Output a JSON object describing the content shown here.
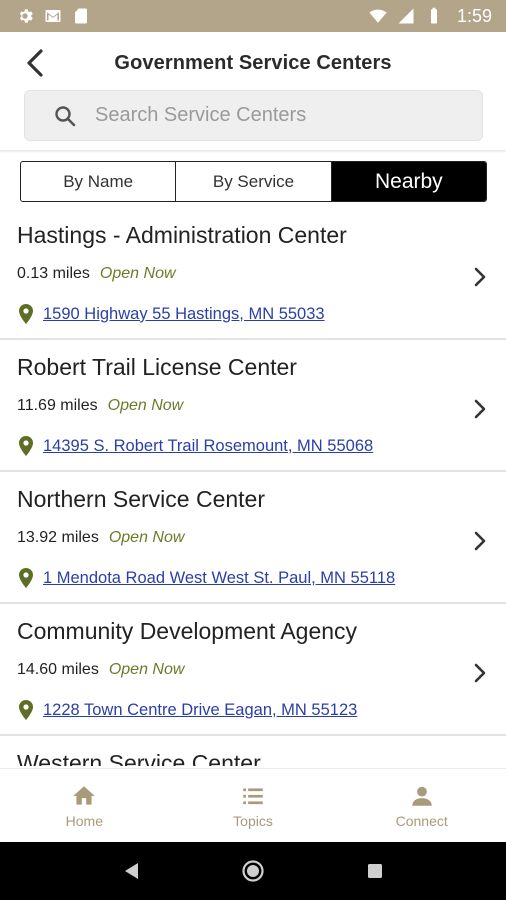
{
  "status_bar": {
    "time": "1:59"
  },
  "header": {
    "title": "Government Service Centers"
  },
  "search": {
    "placeholder": "Search Service Centers"
  },
  "segments": [
    {
      "label": "By Name",
      "active": false
    },
    {
      "label": "By Service",
      "active": false
    },
    {
      "label": "Nearby",
      "active": true
    }
  ],
  "centers": [
    {
      "name": "Hastings - Administration Center",
      "distance": "0.13 miles",
      "status": "Open Now",
      "address": "1590 Highway 55 Hastings, MN 55033"
    },
    {
      "name": "Robert Trail License Center",
      "distance": "11.69 miles",
      "status": "Open Now",
      "address": "14395 S. Robert Trail Rosemount, MN 55068"
    },
    {
      "name": "Northern Service Center",
      "distance": "13.92 miles",
      "status": "Open Now",
      "address": "1 Mendota Road West West St. Paul, MN 55118"
    },
    {
      "name": "Community Development Agency",
      "distance": "14.60 miles",
      "status": "Open Now",
      "address": "1228 Town Centre Drive Eagan, MN 55123"
    },
    {
      "name": "Western Service Center",
      "distance": "",
      "status": "",
      "address": ""
    }
  ],
  "bottom_nav": [
    {
      "label": "Home",
      "icon": "home-icon"
    },
    {
      "label": "Topics",
      "icon": "list-icon"
    },
    {
      "label": "Connect",
      "icon": "person-icon"
    }
  ],
  "colors": {
    "status_bar": "#b3a58a",
    "accent_olive": "#6b7b2a",
    "link": "#2a3fa8",
    "nav_label": "#a99a7c"
  }
}
